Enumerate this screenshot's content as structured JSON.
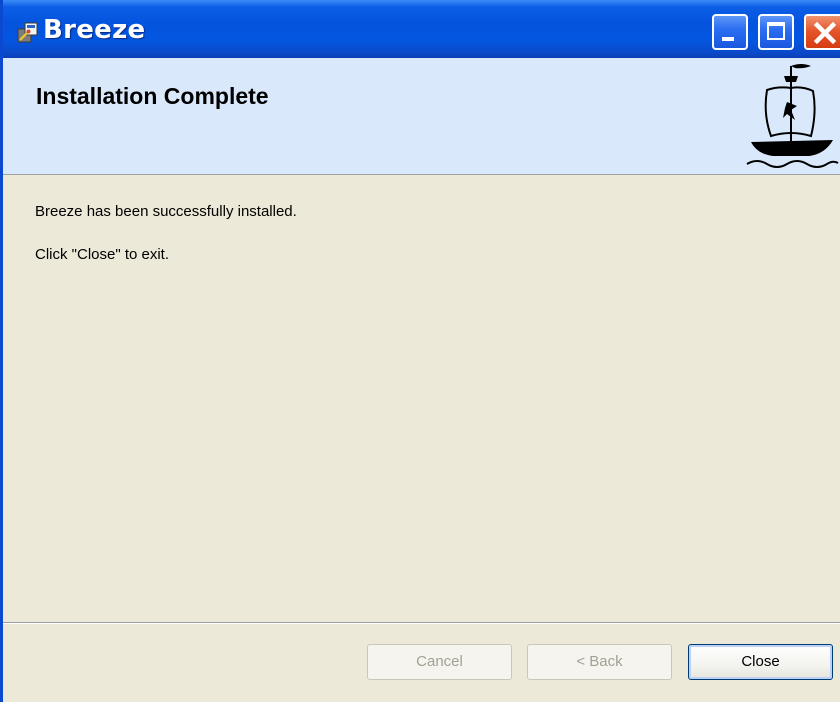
{
  "window": {
    "title": "Breeze",
    "controls": {
      "minimize": "minimize-icon",
      "maximize": "maximize-icon",
      "close": "close-icon"
    }
  },
  "banner": {
    "title": "Installation Complete",
    "logo": "ship-icon"
  },
  "content": {
    "line1": "Breeze has been successfully installed.",
    "line2": "Click \"Close\" to exit."
  },
  "buttons": {
    "cancel": "Cancel",
    "back": "< Back",
    "close": "Close"
  },
  "colors": {
    "titlebar": "#0453de",
    "banner": "#d9e9fb",
    "body": "#ece9d8",
    "close_button": "#e4572d"
  }
}
